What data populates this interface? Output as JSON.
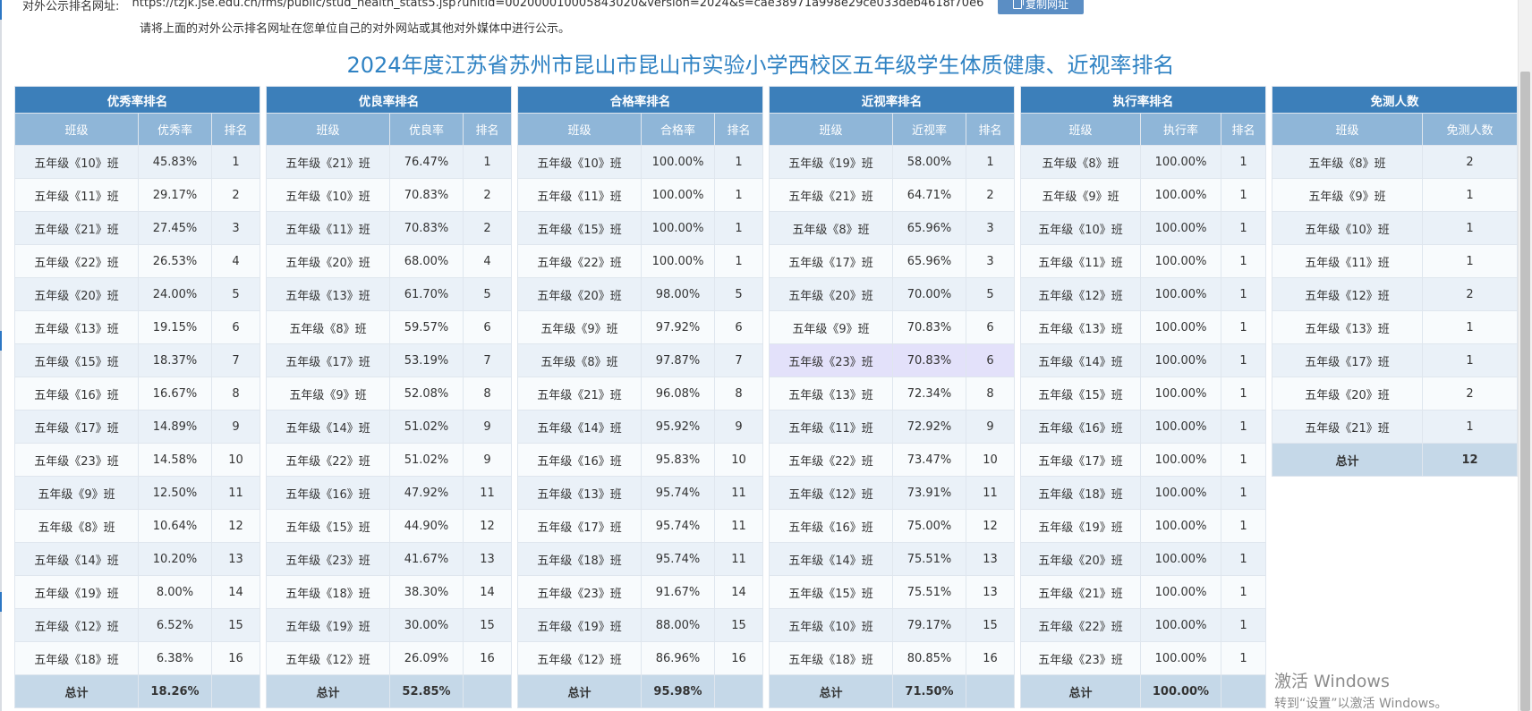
{
  "header": {
    "url_label": "对外公示排名网址:",
    "url": "https://tzjk.jse.edu.cn/fms/public/stud_health_stats5.jsp?unitid=002000010005843020&version=2024&s=cae38971a998e29ce033deb4618f70e6",
    "copy_button": "复制网址",
    "hint": "请将上面的对外公示排名网址在您单位自己的对外网站或其他对外媒体中进行公示。"
  },
  "title": "2024年度江苏省苏州市昆山市昆山市实验小学西校区五年级学生体质健康、近视率排名",
  "tables": [
    {
      "title": "优秀率排名",
      "columns": [
        "班级",
        "优秀率",
        "排名"
      ],
      "rows": [
        [
          "五年级《10》班",
          "45.83%",
          "1"
        ],
        [
          "五年级《11》班",
          "29.17%",
          "2"
        ],
        [
          "五年级《21》班",
          "27.45%",
          "3"
        ],
        [
          "五年级《22》班",
          "26.53%",
          "4"
        ],
        [
          "五年级《20》班",
          "24.00%",
          "5"
        ],
        [
          "五年级《13》班",
          "19.15%",
          "6"
        ],
        [
          "五年级《15》班",
          "18.37%",
          "7"
        ],
        [
          "五年级《16》班",
          "16.67%",
          "8"
        ],
        [
          "五年级《17》班",
          "14.89%",
          "9"
        ],
        [
          "五年级《23》班",
          "14.58%",
          "10"
        ],
        [
          "五年级《9》班",
          "12.50%",
          "11"
        ],
        [
          "五年级《8》班",
          "10.64%",
          "12"
        ],
        [
          "五年级《14》班",
          "10.20%",
          "13"
        ],
        [
          "五年级《19》班",
          "8.00%",
          "14"
        ],
        [
          "五年级《12》班",
          "6.52%",
          "15"
        ],
        [
          "五年级《18》班",
          "6.38%",
          "16"
        ]
      ],
      "total": [
        "总计",
        "18.26%",
        ""
      ]
    },
    {
      "title": "优良率排名",
      "columns": [
        "班级",
        "优良率",
        "排名"
      ],
      "rows": [
        [
          "五年级《21》班",
          "76.47%",
          "1"
        ],
        [
          "五年级《10》班",
          "70.83%",
          "2"
        ],
        [
          "五年级《11》班",
          "70.83%",
          "2"
        ],
        [
          "五年级《20》班",
          "68.00%",
          "4"
        ],
        [
          "五年级《13》班",
          "61.70%",
          "5"
        ],
        [
          "五年级《8》班",
          "59.57%",
          "6"
        ],
        [
          "五年级《17》班",
          "53.19%",
          "7"
        ],
        [
          "五年级《9》班",
          "52.08%",
          "8"
        ],
        [
          "五年级《14》班",
          "51.02%",
          "9"
        ],
        [
          "五年级《22》班",
          "51.02%",
          "9"
        ],
        [
          "五年级《16》班",
          "47.92%",
          "11"
        ],
        [
          "五年级《15》班",
          "44.90%",
          "12"
        ],
        [
          "五年级《23》班",
          "41.67%",
          "13"
        ],
        [
          "五年级《18》班",
          "38.30%",
          "14"
        ],
        [
          "五年级《19》班",
          "30.00%",
          "15"
        ],
        [
          "五年级《12》班",
          "26.09%",
          "16"
        ]
      ],
      "total": [
        "总计",
        "52.85%",
        ""
      ]
    },
    {
      "title": "合格率排名",
      "columns": [
        "班级",
        "合格率",
        "排名"
      ],
      "rows": [
        [
          "五年级《10》班",
          "100.00%",
          "1"
        ],
        [
          "五年级《11》班",
          "100.00%",
          "1"
        ],
        [
          "五年级《15》班",
          "100.00%",
          "1"
        ],
        [
          "五年级《22》班",
          "100.00%",
          "1"
        ],
        [
          "五年级《20》班",
          "98.00%",
          "5"
        ],
        [
          "五年级《9》班",
          "97.92%",
          "6"
        ],
        [
          "五年级《8》班",
          "97.87%",
          "7"
        ],
        [
          "五年级《21》班",
          "96.08%",
          "8"
        ],
        [
          "五年级《14》班",
          "95.92%",
          "9"
        ],
        [
          "五年级《16》班",
          "95.83%",
          "10"
        ],
        [
          "五年级《13》班",
          "95.74%",
          "11"
        ],
        [
          "五年级《17》班",
          "95.74%",
          "11"
        ],
        [
          "五年级《18》班",
          "95.74%",
          "11"
        ],
        [
          "五年级《23》班",
          "91.67%",
          "14"
        ],
        [
          "五年级《19》班",
          "88.00%",
          "15"
        ],
        [
          "五年级《12》班",
          "86.96%",
          "16"
        ]
      ],
      "total": [
        "总计",
        "95.98%",
        ""
      ]
    },
    {
      "title": "近视率排名",
      "columns": [
        "班级",
        "近视率",
        "排名"
      ],
      "highlight_row": 6,
      "rows": [
        [
          "五年级《19》班",
          "58.00%",
          "1"
        ],
        [
          "五年级《21》班",
          "64.71%",
          "2"
        ],
        [
          "五年级《8》班",
          "65.96%",
          "3"
        ],
        [
          "五年级《17》班",
          "65.96%",
          "3"
        ],
        [
          "五年级《20》班",
          "70.00%",
          "5"
        ],
        [
          "五年级《9》班",
          "70.83%",
          "6"
        ],
        [
          "五年级《23》班",
          "70.83%",
          "6"
        ],
        [
          "五年级《13》班",
          "72.34%",
          "8"
        ],
        [
          "五年级《11》班",
          "72.92%",
          "9"
        ],
        [
          "五年级《22》班",
          "73.47%",
          "10"
        ],
        [
          "五年级《12》班",
          "73.91%",
          "11"
        ],
        [
          "五年级《16》班",
          "75.00%",
          "12"
        ],
        [
          "五年级《14》班",
          "75.51%",
          "13"
        ],
        [
          "五年级《15》班",
          "75.51%",
          "13"
        ],
        [
          "五年级《10》班",
          "79.17%",
          "15"
        ],
        [
          "五年级《18》班",
          "80.85%",
          "16"
        ]
      ],
      "total": [
        "总计",
        "71.50%",
        ""
      ]
    },
    {
      "title": "执行率排名",
      "columns": [
        "班级",
        "执行率",
        "排名"
      ],
      "rows": [
        [
          "五年级《8》班",
          "100.00%",
          "1"
        ],
        [
          "五年级《9》班",
          "100.00%",
          "1"
        ],
        [
          "五年级《10》班",
          "100.00%",
          "1"
        ],
        [
          "五年级《11》班",
          "100.00%",
          "1"
        ],
        [
          "五年级《12》班",
          "100.00%",
          "1"
        ],
        [
          "五年级《13》班",
          "100.00%",
          "1"
        ],
        [
          "五年级《14》班",
          "100.00%",
          "1"
        ],
        [
          "五年级《15》班",
          "100.00%",
          "1"
        ],
        [
          "五年级《16》班",
          "100.00%",
          "1"
        ],
        [
          "五年级《17》班",
          "100.00%",
          "1"
        ],
        [
          "五年级《18》班",
          "100.00%",
          "1"
        ],
        [
          "五年级《19》班",
          "100.00%",
          "1"
        ],
        [
          "五年级《20》班",
          "100.00%",
          "1"
        ],
        [
          "五年级《21》班",
          "100.00%",
          "1"
        ],
        [
          "五年级《22》班",
          "100.00%",
          "1"
        ],
        [
          "五年级《23》班",
          "100.00%",
          "1"
        ]
      ],
      "total": [
        "总计",
        "100.00%",
        ""
      ]
    },
    {
      "title": "免测人数",
      "columns": [
        "班级",
        "免测人数"
      ],
      "rows": [
        [
          "五年级《8》班",
          "2"
        ],
        [
          "五年级《9》班",
          "1"
        ],
        [
          "五年级《10》班",
          "1"
        ],
        [
          "五年级《11》班",
          "1"
        ],
        [
          "五年级《12》班",
          "2"
        ],
        [
          "五年级《13》班",
          "1"
        ],
        [
          "五年级《17》班",
          "1"
        ],
        [
          "五年级《20》班",
          "2"
        ],
        [
          "五年级《21》班",
          "1"
        ]
      ],
      "total": [
        "总计",
        "12"
      ]
    }
  ],
  "watermark": {
    "line1": "激活 Windows",
    "line2": "转到“设置”以激活 Windows。"
  },
  "colors": {
    "title": "#2f82c3",
    "table_header": "#3c7fba",
    "column_header": "#8fb6d8",
    "total_row": "#c5d8e8",
    "highlight_row": "#e3e1fa"
  }
}
